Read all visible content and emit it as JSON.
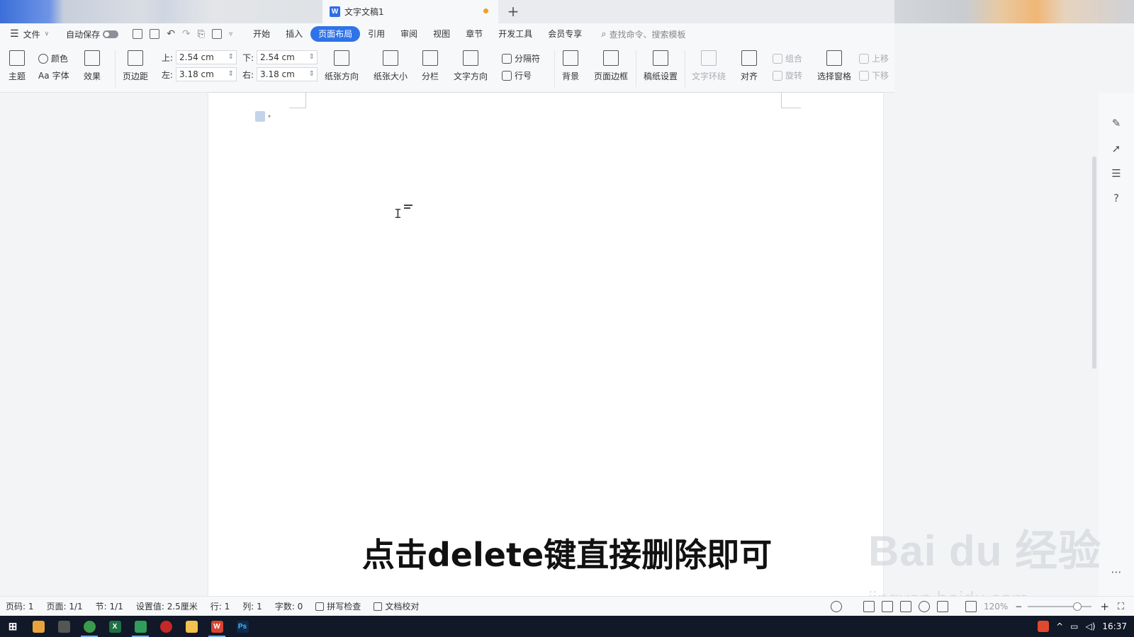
{
  "window": {
    "doc_tab_title": "文字文稿1",
    "new_tab_symbol": "+",
    "app_logo_letter": "W"
  },
  "menubar": {
    "file_label": "文件",
    "autosave_label": "自动保存",
    "tabs": [
      "开始",
      "插入",
      "页面布局",
      "引用",
      "审阅",
      "视图",
      "章节",
      "开发工具",
      "会员专享"
    ],
    "active_tab": "页面布局",
    "search_placeholder": "查找命令、搜索模板"
  },
  "ribbon": {
    "theme_label": "主题",
    "color_label": "颜色",
    "font_label": "字体",
    "font_prefix": "Aa",
    "effect_label": "效果",
    "margins_label": "页边距",
    "top_label": "上:",
    "top_value": "2.54 cm",
    "bottom_label": "下:",
    "bottom_value": "2.54 cm",
    "left_label": "左:",
    "left_value": "3.18 cm",
    "right_label": "右:",
    "right_value": "3.18 cm",
    "orientation_label": "纸张方向",
    "size_label": "纸张大小",
    "columns_label": "分栏",
    "text_direction_label": "文字方向",
    "breaks_label": "分隔符",
    "line_numbers_label": "行号",
    "background_label": "背景",
    "page_border_label": "页面边框",
    "draft_paper_label": "稿纸设置",
    "text_wrap_label": "文字环绕",
    "align_label": "对齐",
    "group_label": "组合",
    "rotate_label": "旋转",
    "selection_pane_label": "选择窗格",
    "bring_forward_label": "上移",
    "send_backward_label": "下移"
  },
  "subtitle": "点击delete键直接删除即可",
  "watermark": {
    "main": "Bai du 经验",
    "url": "jingyan.baidu.com"
  },
  "statusbar": {
    "page_number": "页码: 1",
    "pages": "页面: 1/1",
    "section": "节: 1/1",
    "setting": "设置值: 2.5厘米",
    "row": "行: 1",
    "column": "列: 1",
    "word_count": "字数: 0",
    "spell_check": "拼写检查",
    "doc_proof": "文档校对",
    "zoom": "120%"
  },
  "taskbar": {
    "clock": "16:37"
  }
}
